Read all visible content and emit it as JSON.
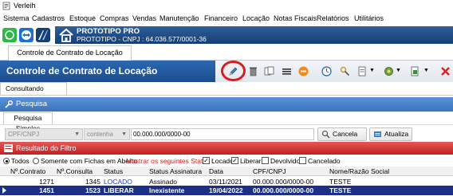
{
  "window": {
    "title": "Verleih"
  },
  "menu": [
    "Sistema",
    "Cadastros",
    "Estoque",
    "Compras",
    "Vendas",
    "Manutenção",
    "Financeiro",
    "Locação",
    "Notas Fiscais",
    "Relatórios",
    "Utilitários"
  ],
  "company": {
    "name": "PROTOTIPO PRO",
    "cnpj_line": "PROTOTIPO - CNPJ : 64.036.577/0001-36"
  },
  "tab": {
    "label": "Controle de Contrato de Locação"
  },
  "form": {
    "title": "Controle de Contrato de Locação",
    "subtab": "Consultando Registros"
  },
  "search": {
    "section_title": "Pesquisa",
    "subtab": "Pesquisa Simples",
    "field": "CPF/CNPJ",
    "operator": "contenha",
    "value": "00.000.000/0000-00",
    "cancel_label": "Cancela",
    "refresh_label": "Atualiza"
  },
  "results": {
    "section_title": "Resultado do Filtro",
    "radio_all": "Todos",
    "radio_open": "Somente com Fichas em Aberto",
    "status_prompt": "Mostrar os seguintes Status :",
    "status_locado": "Locado",
    "status_liberar": "Liberar",
    "status_devolvido": "Devolvido",
    "status_cancelado": "Cancelado",
    "columns": [
      "Nº.Contrato",
      "Nº.Consulta",
      "Status",
      "Status Assinatura",
      "Data",
      "CPF/CNPJ",
      "Nome/Razão Social"
    ],
    "rows": [
      [
        "1271",
        "1345",
        "LOCADO",
        "Assinado",
        "03/11/2021",
        "00.000.000/0000-00",
        "TESTE"
      ],
      [
        "1451",
        "1523",
        "LIBERAR",
        "Inexistente",
        "19/04/2022",
        "00.000.000/0000-00",
        "TESTE"
      ]
    ]
  },
  "colors": {
    "title_blue": "#1b4c8c",
    "result_red": "#c41f1f",
    "selected_row": "#1c2f86",
    "highlight_circle": "#d61e1e"
  }
}
